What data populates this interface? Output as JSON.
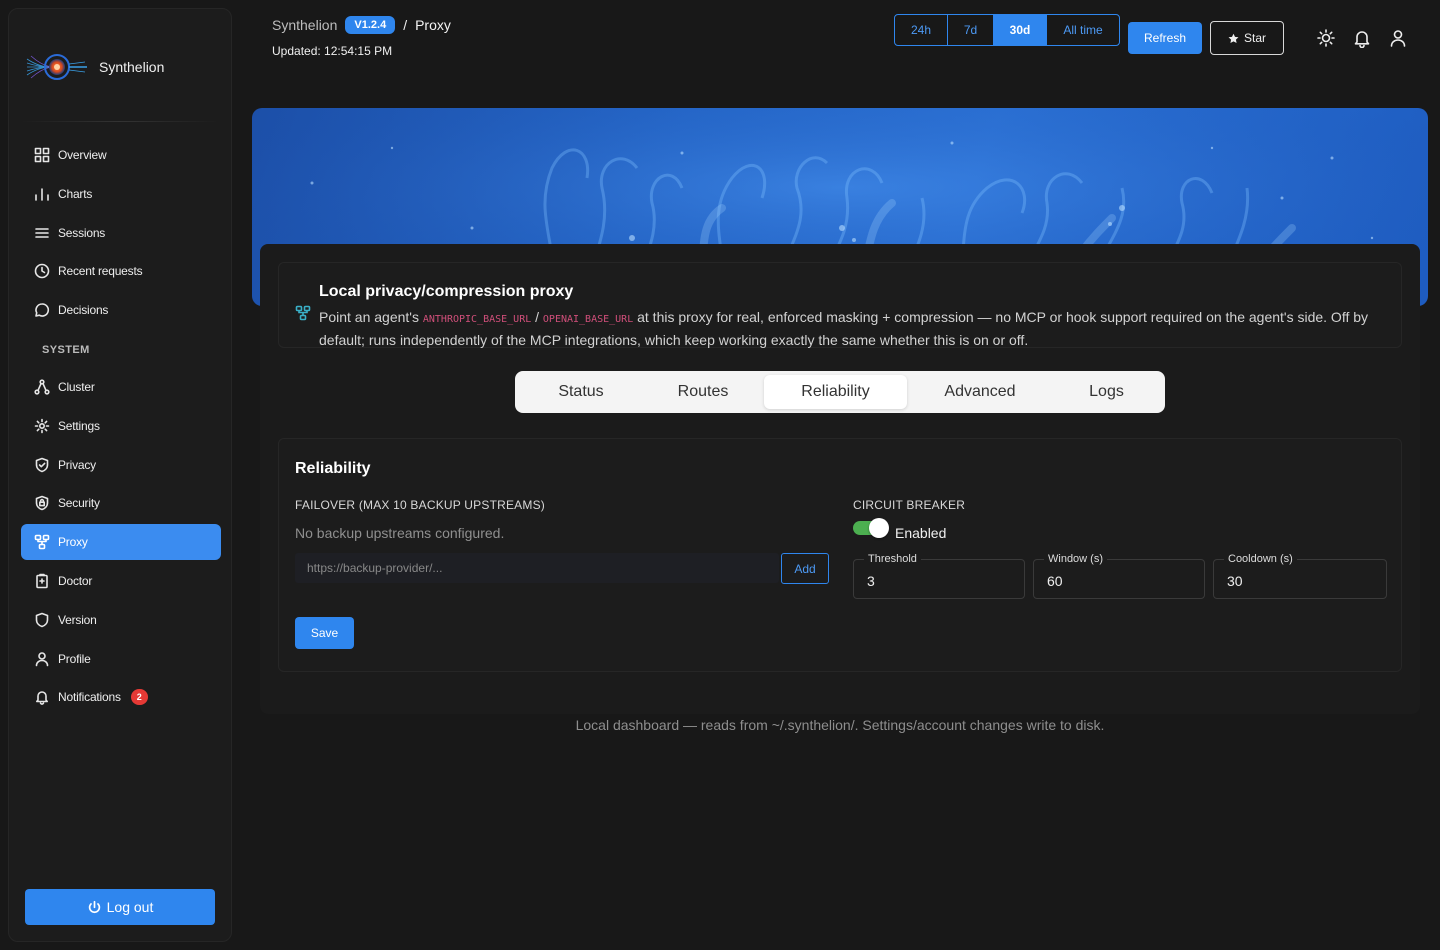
{
  "app": {
    "name": "Synthelion",
    "version": "V1.2.4",
    "crumb_sep": "/",
    "page": "Proxy",
    "updated": "Updated: 12:54:15 PM"
  },
  "header": {
    "ranges": [
      "24h",
      "7d",
      "30d",
      "All time"
    ],
    "active_range": "30d",
    "refresh_label": "Refresh",
    "star_label": "Star"
  },
  "sidebar": {
    "items": [
      {
        "label": "Overview",
        "icon": "grid-icon"
      },
      {
        "label": "Charts",
        "icon": "bar-chart-icon"
      },
      {
        "label": "Sessions",
        "icon": "list-icon"
      },
      {
        "label": "Recent requests",
        "icon": "clock-icon"
      },
      {
        "label": "Decisions",
        "icon": "chat-bubble-icon"
      }
    ],
    "section_label": "SYSTEM",
    "system_items": [
      {
        "label": "Cluster",
        "icon": "cluster-icon"
      },
      {
        "label": "Settings",
        "icon": "gear-icon"
      },
      {
        "label": "Privacy",
        "icon": "shield-check-icon"
      },
      {
        "label": "Security",
        "icon": "shield-lock-icon"
      },
      {
        "label": "Proxy",
        "icon": "proxy-icon",
        "active": true
      },
      {
        "label": "Doctor",
        "icon": "clipboard-icon"
      },
      {
        "label": "Version",
        "icon": "shield-icon"
      },
      {
        "label": "Profile",
        "icon": "user-icon"
      },
      {
        "label": "Notifications",
        "icon": "bell-icon",
        "badge": "2"
      }
    ],
    "logout_label": "Log out"
  },
  "info": {
    "title": "Local privacy/compression proxy",
    "desc_pre": "Point an agent's ",
    "code1": "ANTHROPIC_BASE_URL",
    "desc_sep": " / ",
    "code2": "OPENAI_BASE_URL",
    "desc_post": " at this proxy for real, enforced masking + compression — no MCP or hook support required on the agent's side. Off by default; runs independently of the MCP integrations, which keep working exactly the same whether this is on or off."
  },
  "tabs": [
    "Status",
    "Routes",
    "Reliability",
    "Advanced",
    "Logs"
  ],
  "active_tab": "Reliability",
  "reliability": {
    "title": "Reliability",
    "failover_label": "FAILOVER (MAX 10 BACKUP UPSTREAMS)",
    "no_backups": "No backup upstreams configured.",
    "backup_placeholder": "https://backup-provider/...",
    "add_label": "Add",
    "save_label": "Save",
    "circuit_label": "CIRCUIT BREAKER",
    "enabled": true,
    "enabled_label": "Enabled",
    "threshold_label": "Threshold",
    "threshold": "3",
    "window_label": "Window (s)",
    "window": "60",
    "cooldown_label": "Cooldown (s)",
    "cooldown": "30"
  },
  "footer": "Local dashboard — reads from ~/.synthelion/. Settings/account changes write to disk.",
  "colors": {
    "accent": "#2f86ee",
    "toggle_on": "#4caf50",
    "badge": "#e53935",
    "code": "#d04f7a"
  }
}
